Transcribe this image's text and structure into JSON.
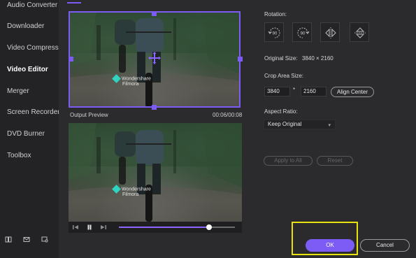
{
  "sidebar": {
    "items": [
      {
        "label": "Audio Converter"
      },
      {
        "label": "Downloader"
      },
      {
        "label": "Video Compressor"
      },
      {
        "label": "Video Editor"
      },
      {
        "label": "Merger"
      },
      {
        "label": "Screen Recorder"
      },
      {
        "label": "DVD Burner"
      },
      {
        "label": "Toolbox"
      }
    ],
    "active_item": "Video Editor"
  },
  "preview": {
    "watermark_brand_line1": "Wondershare",
    "watermark_brand_line2": "Filmora",
    "output_preview_label": "Output Preview",
    "timecode": "00:06/00:08",
    "progress_fraction": 0.78
  },
  "crop_panel": {
    "rotation_label": "Rotation:",
    "rotate_left_text": "90",
    "rotate_right_text": "90",
    "original_size_label": "Original Size:",
    "original_size_value": "3840 × 2160",
    "crop_area_label": "Crop Area Size:",
    "crop_width": "3840",
    "crop_separator": "*",
    "crop_height": "2160",
    "align_center_label": "Align Center",
    "aspect_ratio_label": "Aspect Ratio:",
    "aspect_ratio_value": "Keep Original",
    "apply_to_all_label": "Apply to All",
    "reset_label": "Reset"
  },
  "footer": {
    "ok_label": "OK",
    "cancel_label": "Cancel"
  },
  "colors": {
    "accent": "#7d5cf6",
    "highlight": "#e8e30f",
    "sidebar_bg": "#232326",
    "main_bg": "#2b2b2e"
  },
  "icons": [
    "rotate-left-icon",
    "rotate-right-icon",
    "flip-horizontal-icon",
    "flip-vertical-icon",
    "prev-frame-icon",
    "pause-icon",
    "next-frame-icon",
    "book-icon",
    "mail-icon",
    "feedback-icon",
    "move-cross-icon"
  ]
}
